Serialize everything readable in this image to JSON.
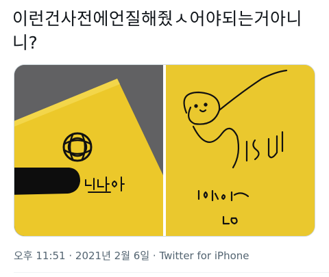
{
  "tweet": {
    "text": "이런건사전에언질해줬ㅅ어야되는거아니니?"
  },
  "media": {
    "left_icon": "nct-logo-icon",
    "right_icon": "signature-icon"
  },
  "meta": {
    "time": "오후 11:51",
    "separator1": " · ",
    "date": "2021년 2월 6일",
    "separator2": " · ",
    "via": "Twitter for iPhone"
  }
}
